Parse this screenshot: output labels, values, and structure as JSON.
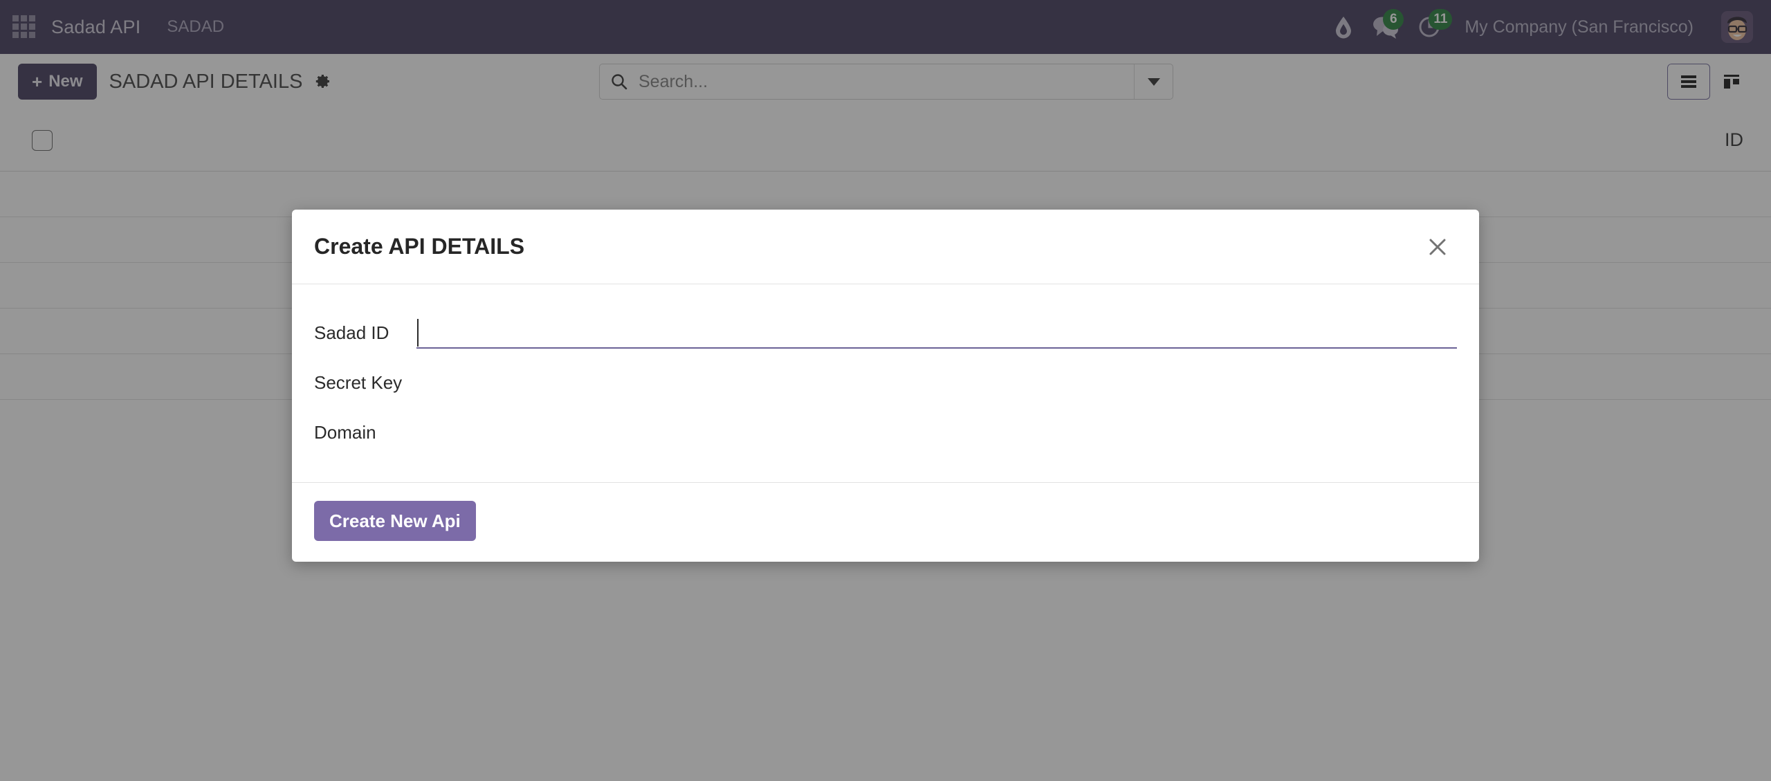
{
  "navbar": {
    "apps_icon": "apps-grid-icon",
    "brand": "Sadad API",
    "menu_item": "SADAD",
    "drop_icon": "water-drop-icon",
    "messages_icon": "chat-bubbles-icon",
    "messages_count": "6",
    "activities_icon": "clock-activity-icon",
    "activities_count": "11",
    "company": "My Company (San Francisco)",
    "avatar": "user-avatar",
    "background_color": "#3c3557",
    "badge_color": "#1e7b34"
  },
  "toolbar": {
    "new_label": "New",
    "new_plus": "+",
    "breadcrumb": "SADAD API DETAILS",
    "settings_icon": "gear-icon",
    "search": {
      "icon": "search-icon",
      "value": "",
      "placeholder": "Search...",
      "toggle_icon": "chevron-down-icon"
    },
    "views": [
      {
        "name": "list-view",
        "icon": "list-icon",
        "active": true
      },
      {
        "name": "kanban-view",
        "icon": "kanban-icon",
        "active": false
      }
    ]
  },
  "listview": {
    "select_all_checkbox": "select-all",
    "columns": [
      "ID"
    ],
    "rows": []
  },
  "modal": {
    "title": "Create API DETAILS",
    "close_icon": "close-icon",
    "fields": [
      {
        "label": "Sadad ID",
        "value": "",
        "focused": true
      },
      {
        "label": "Secret Key",
        "value": "",
        "focused": false
      },
      {
        "label": "Domain",
        "value": "",
        "focused": false
      }
    ],
    "submit_label": "Create New Api",
    "submit_color": "#7c6ba8"
  }
}
